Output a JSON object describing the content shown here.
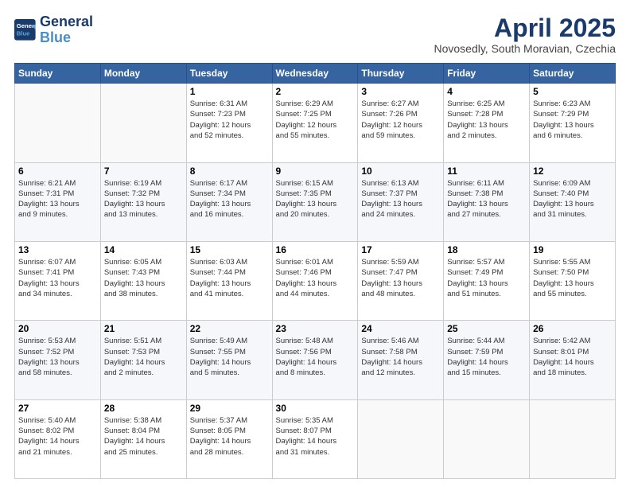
{
  "header": {
    "logo_line1": "General",
    "logo_line2": "Blue",
    "month": "April 2025",
    "location": "Novosedly, South Moravian, Czechia"
  },
  "weekdays": [
    "Sunday",
    "Monday",
    "Tuesday",
    "Wednesday",
    "Thursday",
    "Friday",
    "Saturday"
  ],
  "weeks": [
    [
      {
        "day": "",
        "info": ""
      },
      {
        "day": "",
        "info": ""
      },
      {
        "day": "1",
        "info": "Sunrise: 6:31 AM\nSunset: 7:23 PM\nDaylight: 12 hours\nand 52 minutes."
      },
      {
        "day": "2",
        "info": "Sunrise: 6:29 AM\nSunset: 7:25 PM\nDaylight: 12 hours\nand 55 minutes."
      },
      {
        "day": "3",
        "info": "Sunrise: 6:27 AM\nSunset: 7:26 PM\nDaylight: 12 hours\nand 59 minutes."
      },
      {
        "day": "4",
        "info": "Sunrise: 6:25 AM\nSunset: 7:28 PM\nDaylight: 13 hours\nand 2 minutes."
      },
      {
        "day": "5",
        "info": "Sunrise: 6:23 AM\nSunset: 7:29 PM\nDaylight: 13 hours\nand 6 minutes."
      }
    ],
    [
      {
        "day": "6",
        "info": "Sunrise: 6:21 AM\nSunset: 7:31 PM\nDaylight: 13 hours\nand 9 minutes."
      },
      {
        "day": "7",
        "info": "Sunrise: 6:19 AM\nSunset: 7:32 PM\nDaylight: 13 hours\nand 13 minutes."
      },
      {
        "day": "8",
        "info": "Sunrise: 6:17 AM\nSunset: 7:34 PM\nDaylight: 13 hours\nand 16 minutes."
      },
      {
        "day": "9",
        "info": "Sunrise: 6:15 AM\nSunset: 7:35 PM\nDaylight: 13 hours\nand 20 minutes."
      },
      {
        "day": "10",
        "info": "Sunrise: 6:13 AM\nSunset: 7:37 PM\nDaylight: 13 hours\nand 24 minutes."
      },
      {
        "day": "11",
        "info": "Sunrise: 6:11 AM\nSunset: 7:38 PM\nDaylight: 13 hours\nand 27 minutes."
      },
      {
        "day": "12",
        "info": "Sunrise: 6:09 AM\nSunset: 7:40 PM\nDaylight: 13 hours\nand 31 minutes."
      }
    ],
    [
      {
        "day": "13",
        "info": "Sunrise: 6:07 AM\nSunset: 7:41 PM\nDaylight: 13 hours\nand 34 minutes."
      },
      {
        "day": "14",
        "info": "Sunrise: 6:05 AM\nSunset: 7:43 PM\nDaylight: 13 hours\nand 38 minutes."
      },
      {
        "day": "15",
        "info": "Sunrise: 6:03 AM\nSunset: 7:44 PM\nDaylight: 13 hours\nand 41 minutes."
      },
      {
        "day": "16",
        "info": "Sunrise: 6:01 AM\nSunset: 7:46 PM\nDaylight: 13 hours\nand 44 minutes."
      },
      {
        "day": "17",
        "info": "Sunrise: 5:59 AM\nSunset: 7:47 PM\nDaylight: 13 hours\nand 48 minutes."
      },
      {
        "day": "18",
        "info": "Sunrise: 5:57 AM\nSunset: 7:49 PM\nDaylight: 13 hours\nand 51 minutes."
      },
      {
        "day": "19",
        "info": "Sunrise: 5:55 AM\nSunset: 7:50 PM\nDaylight: 13 hours\nand 55 minutes."
      }
    ],
    [
      {
        "day": "20",
        "info": "Sunrise: 5:53 AM\nSunset: 7:52 PM\nDaylight: 13 hours\nand 58 minutes."
      },
      {
        "day": "21",
        "info": "Sunrise: 5:51 AM\nSunset: 7:53 PM\nDaylight: 14 hours\nand 2 minutes."
      },
      {
        "day": "22",
        "info": "Sunrise: 5:49 AM\nSunset: 7:55 PM\nDaylight: 14 hours\nand 5 minutes."
      },
      {
        "day": "23",
        "info": "Sunrise: 5:48 AM\nSunset: 7:56 PM\nDaylight: 14 hours\nand 8 minutes."
      },
      {
        "day": "24",
        "info": "Sunrise: 5:46 AM\nSunset: 7:58 PM\nDaylight: 14 hours\nand 12 minutes."
      },
      {
        "day": "25",
        "info": "Sunrise: 5:44 AM\nSunset: 7:59 PM\nDaylight: 14 hours\nand 15 minutes."
      },
      {
        "day": "26",
        "info": "Sunrise: 5:42 AM\nSunset: 8:01 PM\nDaylight: 14 hours\nand 18 minutes."
      }
    ],
    [
      {
        "day": "27",
        "info": "Sunrise: 5:40 AM\nSunset: 8:02 PM\nDaylight: 14 hours\nand 21 minutes."
      },
      {
        "day": "28",
        "info": "Sunrise: 5:38 AM\nSunset: 8:04 PM\nDaylight: 14 hours\nand 25 minutes."
      },
      {
        "day": "29",
        "info": "Sunrise: 5:37 AM\nSunset: 8:05 PM\nDaylight: 14 hours\nand 28 minutes."
      },
      {
        "day": "30",
        "info": "Sunrise: 5:35 AM\nSunset: 8:07 PM\nDaylight: 14 hours\nand 31 minutes."
      },
      {
        "day": "",
        "info": ""
      },
      {
        "day": "",
        "info": ""
      },
      {
        "day": "",
        "info": ""
      }
    ]
  ]
}
